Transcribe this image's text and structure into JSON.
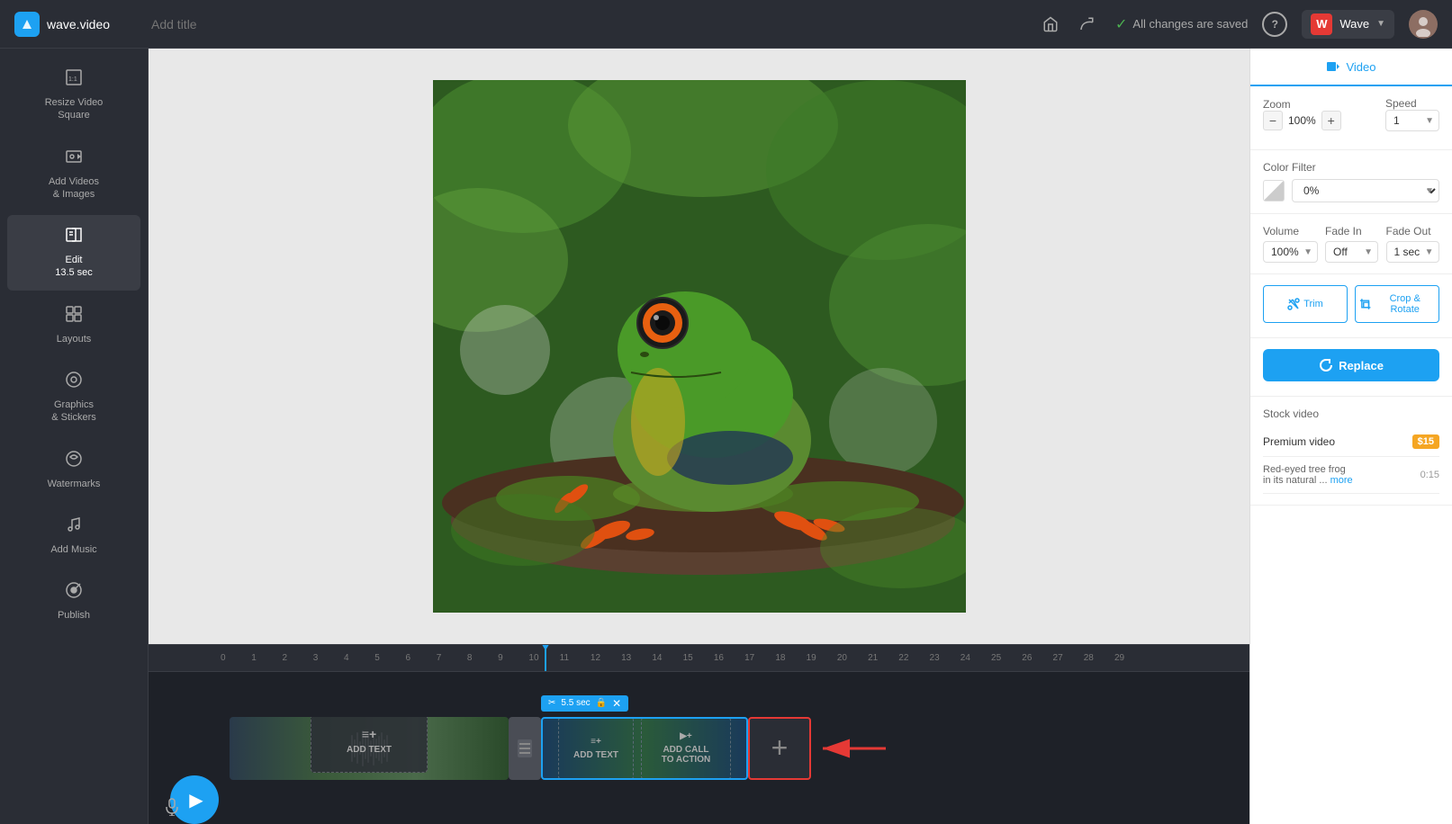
{
  "app": {
    "logo_text": "wave.video",
    "title_placeholder": "Add title"
  },
  "topbar": {
    "saved_text": "All changes are saved",
    "help_label": "?",
    "workspace_name": "Wave",
    "undo_label": "↩",
    "redo_label": "↪"
  },
  "sidebar": {
    "items": [
      {
        "id": "resize",
        "icon": "⊞",
        "label": "Resize Video\nSquare"
      },
      {
        "id": "add-videos",
        "icon": "🖼",
        "label": "Add Videos\n& Images"
      },
      {
        "id": "edit",
        "icon": "✏️",
        "label": "Edit\n13.5 sec",
        "active": true
      },
      {
        "id": "layouts",
        "icon": "⊟",
        "label": "Layouts"
      },
      {
        "id": "graphics",
        "icon": "◎",
        "label": "Graphics\n& Stickers"
      },
      {
        "id": "watermarks",
        "icon": "⚙",
        "label": "Watermarks"
      },
      {
        "id": "music",
        "icon": "♪",
        "label": "Add Music"
      },
      {
        "id": "publish",
        "icon": "↗",
        "label": "Publish"
      }
    ]
  },
  "right_panel": {
    "tab_label": "Video",
    "zoom_label": "Zoom",
    "speed_label": "Speed",
    "zoom_value": "100%",
    "speed_value": "1",
    "zoom_minus": "−",
    "zoom_plus": "+",
    "color_filter_label": "Color Filter",
    "color_filter_value": "0%",
    "volume_label": "Volume",
    "fade_in_label": "Fade In",
    "fade_out_label": "Fade Out",
    "volume_value": "100%",
    "fade_in_value": "Off",
    "fade_out_value": "1 sec",
    "trim_label": "Trim",
    "crop_label": "Crop & Rotate",
    "replace_label": "Replace",
    "stock_video_label": "Stock video",
    "premium_label": "Premium video",
    "premium_price": "$15",
    "stock_title": "Red-eyed tree frog\nin its natural ...",
    "stock_more": "more",
    "stock_duration": "0:15"
  },
  "timeline": {
    "clip_duration": "5.5 sec",
    "add_text_label": "ADD TEXT",
    "add_cta_label": "ADD CALL\nTO ACTION",
    "ruler_marks": [
      "0",
      "1",
      "2",
      "3",
      "4",
      "5",
      "6",
      "7",
      "8",
      "9",
      "10",
      "11",
      "12",
      "13",
      "14",
      "15",
      "16",
      "17",
      "18",
      "19",
      "20",
      "21",
      "22",
      "23",
      "24",
      "25",
      "26",
      "27",
      "28",
      "29"
    ]
  }
}
